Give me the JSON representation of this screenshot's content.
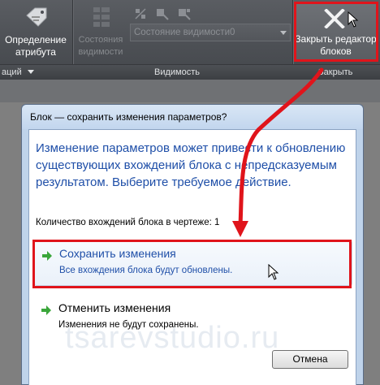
{
  "ribbon": {
    "attr_button_label": "Определение атрибута",
    "state_button_label": "Состояния видимости",
    "combo_value": "Состояние видимости0",
    "close_button_label": "Закрыть редактор блоков",
    "footer": {
      "left_label": "аций",
      "visibility_label": "Видимость",
      "close_label": "Закрыть"
    }
  },
  "dialog": {
    "title": "Блок — сохранить изменения параметров?",
    "instruction": "Изменение параметров может привести к обновлению существующих вхождений блока с непредсказуемым результатом. Выберите требуемое действие.",
    "count_text": "Количество вхождений блока в чертеже: 1",
    "options": [
      {
        "title": "Сохранить изменения",
        "description": "Все вхождения блока будут обновлены."
      },
      {
        "title": "Отменить изменения",
        "description": "Изменения не будут сохранены."
      }
    ],
    "cancel_button": "Отмена"
  },
  "watermark": "tsarevstudio.ru",
  "colors": {
    "highlight": "#e0141b",
    "instruction_text": "#1f4fa8",
    "option_arrow": "#3aa63a"
  }
}
